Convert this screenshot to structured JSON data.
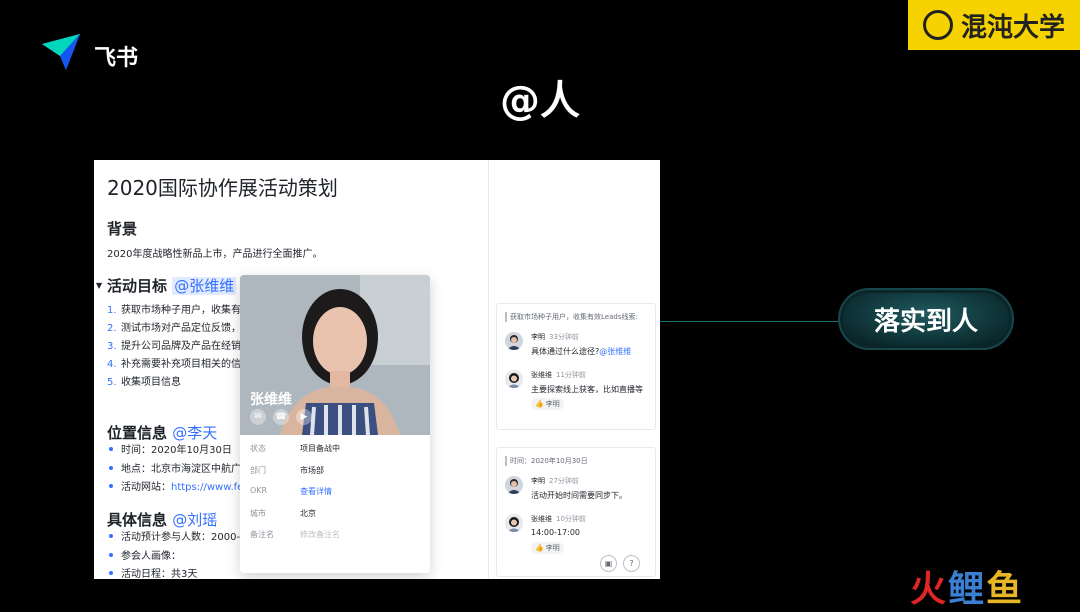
{
  "app": {
    "name": "飞书",
    "slide_title": "@人",
    "brand": "混沌大学",
    "watermark": [
      "火",
      "鲤",
      "鱼"
    ]
  },
  "doc": {
    "title": "2020国际协作展活动策划",
    "background_heading": "背景",
    "background_text": "2020年度战略性新品上市，产品进行全面推广。",
    "goal_heading": "活动目标",
    "goal_mention": "@张维维",
    "goals": [
      {
        "num": "1.",
        "text": "获取市场种子用户，收集有效"
      },
      {
        "num": "2.",
        "text": "测试市场对产品定位反馈，佢"
      },
      {
        "num": "3.",
        "text": "提升公司品牌及产品在经销商"
      },
      {
        "num": "4.",
        "text": "补充需要补充项目相关的信息"
      },
      {
        "num": "5.",
        "text": "收集项目信息"
      }
    ],
    "location_heading": "位置信息",
    "location_mention": "@李天",
    "location_items": [
      {
        "prefix": "时间：",
        "value": "2020年10月30日"
      },
      {
        "prefix": "地点：",
        "value": "北京市海淀区中航广场"
      },
      {
        "prefix": "活动网站：",
        "value": "https://www.feish"
      }
    ],
    "detail_heading": "具体信息",
    "detail_mention": "@刘瑶",
    "detail_items": [
      {
        "text": "活动预计参与人数：2000-30"
      },
      {
        "text": "参会人画像："
      },
      {
        "text": "活动日程：共3天"
      }
    ]
  },
  "profile_card": {
    "name": "张维维",
    "actions": [
      "chat-icon",
      "phone-icon",
      "video-icon"
    ],
    "rows": [
      {
        "key": "状态",
        "value": "项目备战中"
      },
      {
        "key": "部门",
        "value": "市场部"
      },
      {
        "key": "OKR",
        "value": "查看详情"
      },
      {
        "key": "城市",
        "value": "北京"
      },
      {
        "key": "备注名",
        "value": "修改备注名"
      }
    ]
  },
  "comments": [
    {
      "quote": "获取市场种子用户，收集有效Leads线索:",
      "items": [
        {
          "name": "李明",
          "time": "33分钟前",
          "text": "具体通过什么途径?",
          "mention": "@张维维",
          "reaction": ""
        },
        {
          "name": "张维维",
          "time": "11分钟前",
          "text": "主要探索线上获客，比如直播等",
          "mention": "",
          "reaction": "李明"
        }
      ]
    },
    {
      "quote": "时间：2020年10月30日",
      "items": [
        {
          "name": "李明",
          "time": "27分钟前",
          "text": "活动开始时间需要同步下。",
          "mention": "",
          "reaction": ""
        },
        {
          "name": "张维维",
          "time": "10分钟前",
          "text": "14:00-17:00",
          "mention": "",
          "reaction": "李明"
        }
      ]
    }
  ],
  "callout": {
    "label": "落实到人"
  },
  "colors": {
    "accent": "#3370ff",
    "brand_yellow": "#f5d200",
    "pill": "#0d2f33"
  }
}
